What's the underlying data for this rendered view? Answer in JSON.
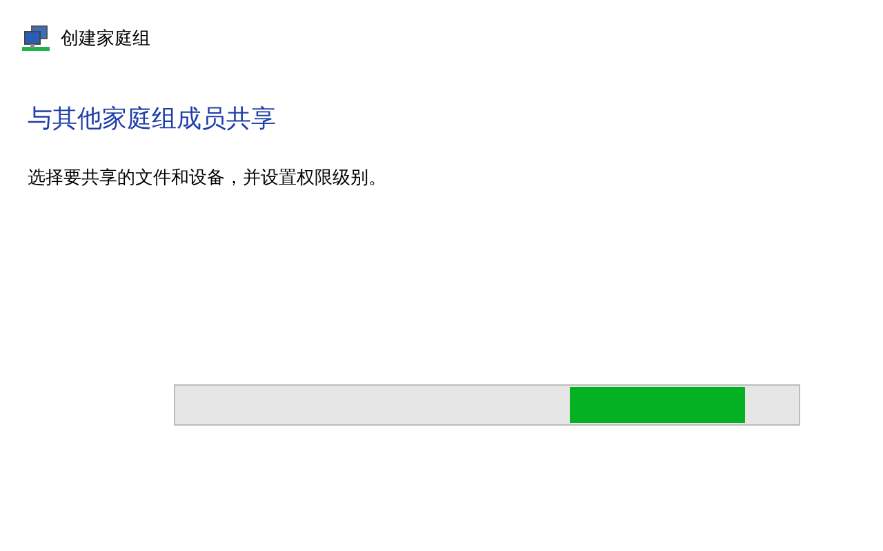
{
  "window": {
    "title": "创建家庭组"
  },
  "heading": "与其他家庭组成员共享",
  "description": "选择要共享的文件和设备，并设置权限级别。",
  "progress": {
    "kind": "marquee"
  }
}
